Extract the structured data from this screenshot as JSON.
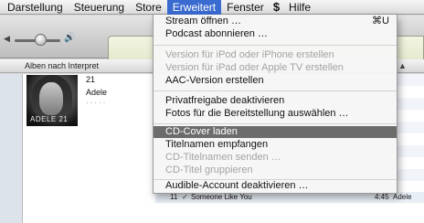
{
  "menubar": {
    "items": [
      "Darstellung",
      "Steuerung",
      "Store",
      "Erweitert",
      "Fenster",
      "Hilfe"
    ],
    "script_icon": "$"
  },
  "library": {
    "column_header": "Alben nach Interpret",
    "column_header_arrow": "▲"
  },
  "album": {
    "number": "21",
    "artist": "Adele",
    "cover_text": "ADELE 21",
    "rating_dots": "·····"
  },
  "track": {
    "number": "11",
    "check": "✓",
    "title": "Someone Like You",
    "time": "4:45",
    "artist": "Adele"
  },
  "menu": {
    "items": [
      {
        "label": "Stream öffnen …",
        "shortcut": "⌘U",
        "enabled": true
      },
      {
        "label": "Podcast abonnieren …",
        "shortcut": "",
        "enabled": true
      },
      {
        "label": "Version für iPod oder iPhone erstellen",
        "shortcut": "",
        "enabled": false
      },
      {
        "label": "Version für iPad oder Apple TV erstellen",
        "shortcut": "",
        "enabled": false
      },
      {
        "label": "AAC-Version erstellen",
        "shortcut": "",
        "enabled": true
      },
      {
        "label": "Privatfreigabe deaktivieren",
        "shortcut": "",
        "enabled": true
      },
      {
        "label": "Fotos für die Bereitstellung auswählen …",
        "shortcut": "",
        "enabled": true
      },
      {
        "label": "CD-Cover laden",
        "shortcut": "",
        "enabled": true,
        "selected": true
      },
      {
        "label": "Titelnamen empfangen",
        "shortcut": "",
        "enabled": true
      },
      {
        "label": "CD-Titelnamen senden …",
        "shortcut": "",
        "enabled": false
      },
      {
        "label": "CD-Titel gruppieren",
        "shortcut": "",
        "enabled": false
      },
      {
        "label": "Audible-Account deaktivieren …",
        "shortcut": "",
        "enabled": true
      }
    ]
  },
  "colors": {
    "menubar_active": "#3a6bd0",
    "menu_selected": "#6c6c6c",
    "disabled_text": "#a3a3a3"
  }
}
